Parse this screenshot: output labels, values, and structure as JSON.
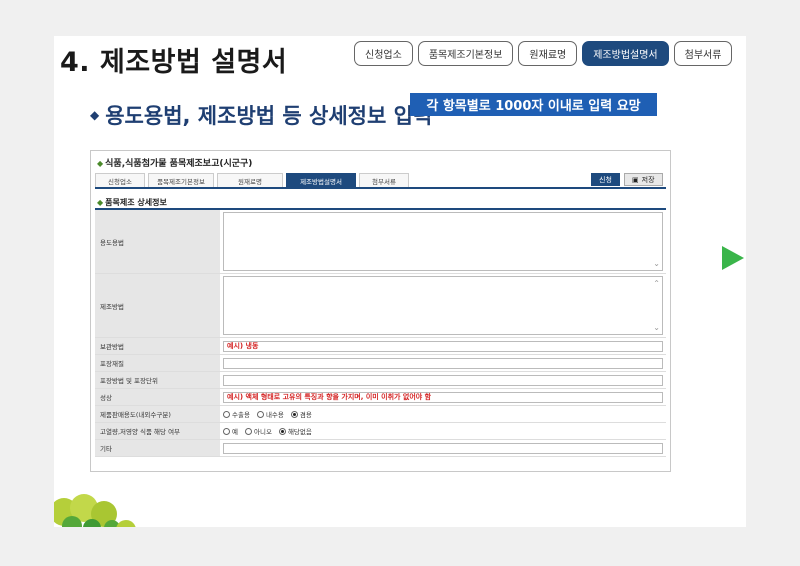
{
  "header": {
    "title": "4. 제조방법 설명서",
    "steps": [
      "신청업소",
      "품목제조기본정보",
      "원재료명",
      "제조방법설명서",
      "첨부서류"
    ],
    "active_step": 3
  },
  "subtitle": "용도용법, 제조방법 등 상세정보 입력",
  "panel": {
    "title": "식품,식품첨가물 품목제조보고(시군구)",
    "tabs": [
      "신청업소",
      "품목제조기본정보",
      "원재료명",
      "제조방법설명서",
      "첨부서류"
    ],
    "active_tab": 3,
    "apply_label": "신청",
    "save_label": "저장",
    "section_title": "품목제조 상세정보",
    "callout": "각 항목별로 1000자 이내로 입력 요망",
    "fields": {
      "usage_label": "용도용법",
      "method_label": "제조방법",
      "storage_label": "보관방법",
      "storage_value": "예시) 냉동",
      "packaging_material_label": "포장재질",
      "packaging_unit_label": "포장방법 및 포장단위",
      "properties_label": "성상",
      "properties_value": "예시) 액체 형태로 고유의 특징과 향을 가지며, 이미 이취가 없어야 함",
      "sales_label": "제품판매용도(내외수구분)",
      "sales_options": [
        "수출용",
        "내수용",
        "겸용"
      ],
      "sales_selected": 2,
      "highcal_label": "고열량,저영양 식품 해당 여부",
      "highcal_options": [
        "예",
        "아니오",
        "해당없음"
      ],
      "highcal_selected": 2,
      "etc_label": "기타"
    }
  },
  "colors": {
    "brand": "#1e4a7e",
    "callout": "#1f5fb4",
    "arrow": "#3ab54a",
    "example_text": "#d42424"
  }
}
